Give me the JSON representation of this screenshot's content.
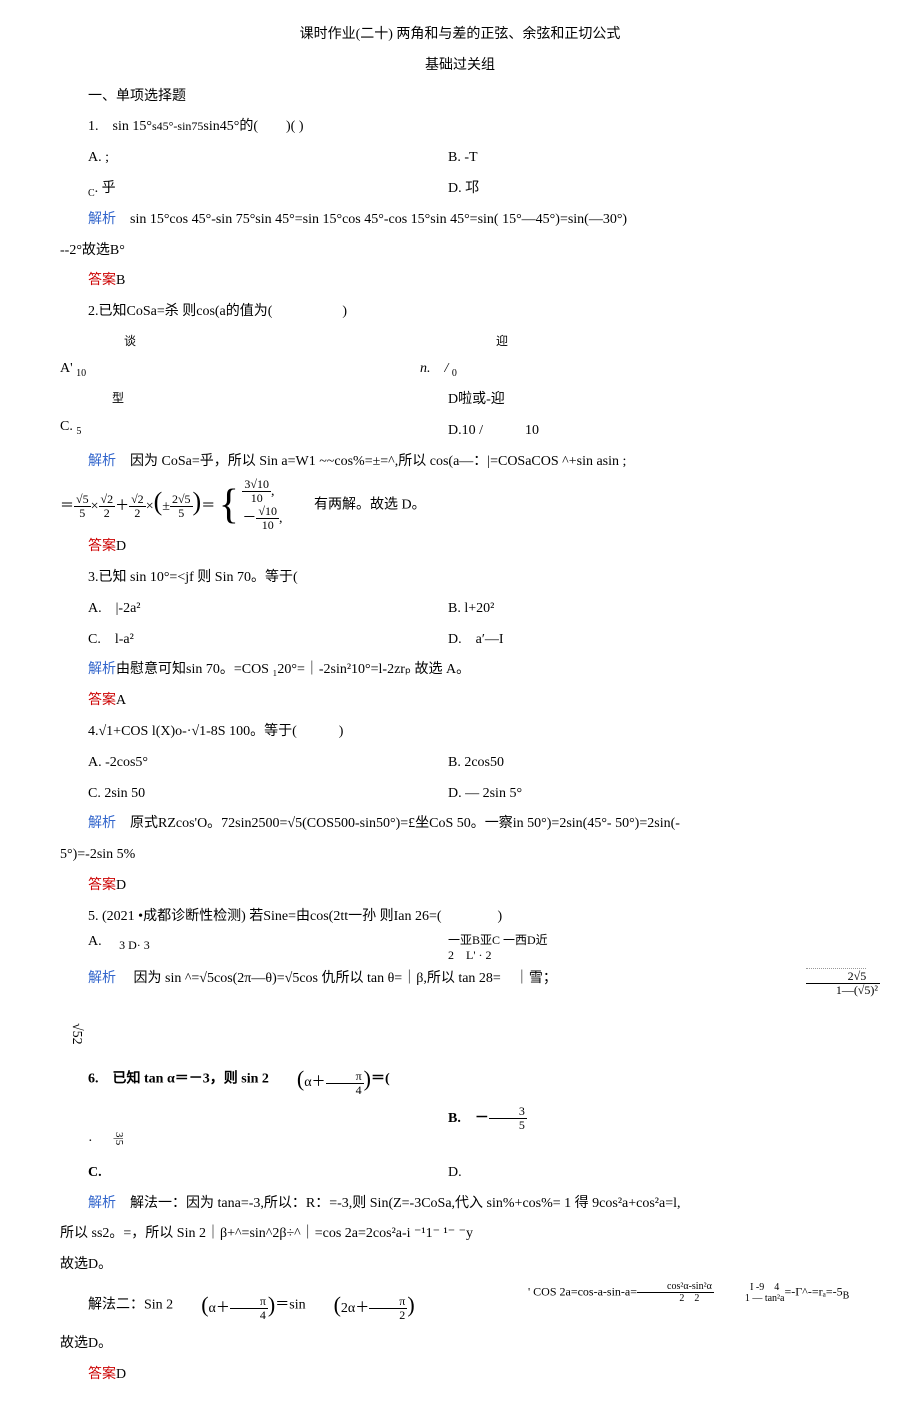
{
  "header": {
    "title": "课时作业(二十) 两角和与差的正弦、余弦和正切公式",
    "subtitle": "基础过关组"
  },
  "s1_title": "一、单项选择题",
  "q1": {
    "stem_pre": "1.　sin 15°",
    "stem_mid": "s45°-sin75",
    "stem_post": "sin45°的(　　)(  )",
    "A": "A. ;",
    "B": "B. -T",
    "C_pre": "C",
    "C_post": ". 乎",
    "D": "D. 邛",
    "analysis_label": "解析",
    "analysis": "　sin 15°cos 45°-sin 75°sin 45°=sin 15°cos 45°-cos 15°sin 45°=sin( 15°—45°)=sin(—30°)",
    "analysis_tail": "--2°故选B°",
    "answer_label": "答案",
    "answer": "B"
  },
  "q2": {
    "stem": "2.已知CoSa=杀 则cos(a的值为(　　　　　)",
    "A_pre": "A",
    "A_post": "' ",
    "A_sub": "10",
    "A_top": "谈",
    "B_pre": "n.　/ ",
    "B_sub": "0",
    "B_top": "迎",
    "C_pre": "C. ",
    "C_sub": "5",
    "C_top": "型",
    "D": "D啦或-迎",
    "D2": "D.10 /　　　10",
    "analysis_label": "解析",
    "analysis": "　因为 CoSa=乎，所以 Sin a=W1 ~~cos%=±=^,所以 cos(a—：|=COSaCOS ^+sin asin ;",
    "tail": "　　有两解。故选 D。",
    "answer_label": "答案",
    "answer": "D"
  },
  "q3": {
    "stem": "3.已知 sin 10°=<jf 则 Sin 70。等于(",
    "A": "A.　|-2a²",
    "B": "B. l+20²",
    "C": "C.　l-a²",
    "D": "D.　a′—I",
    "analysis_label": "解析",
    "analysis": "由慰意可知sin 70。=COS ₁20°=｜-2sin²10°=l-2zrₚ 故选 A。",
    "answer_label": "答案",
    "answer": "A"
  },
  "q4": {
    "stem": "4.√1+COS l(X)o-·√1-8S 100。等于(　　　)",
    "A": "A. -2cos5°",
    "B": "B. 2cos50",
    "C": "C. 2sin 50",
    "D": "D. — 2sin 5°",
    "analysis_label": "解析",
    "analysis": "　原式RZcos'O。72sin2500=√5(COS500-sin50°)=£坐CoS 50。一察in 50°)=2sin(45°- 50°)=2sin(-",
    "analysis_tail": "5°)=-2sin 5%",
    "answer_label": "答案",
    "answer": "D"
  },
  "q5": {
    "stem": "5. (2021 •成都诊断性检测) 若Sine=由cos(2tt一孙 则Ian 26=(　　　　)",
    "opts_a": "A.　",
    "opts_mid": "3 D· 3",
    "opts_b": "一亚B亚C 一西D近",
    "opts_c": "2　L' · 2",
    "analysis_label": "解析",
    "analysis": "　 因为 sin ^=√5cos(2π—θ)=√5cos 仇所以 tan θ=｜β,所以 tan 28=　｜雪；",
    "tail_sym": "√52",
    "frac_num": "2√5",
    "frac_den": "1—(√5)²"
  },
  "q6": {
    "stem_pre": "6.　已知 tan α＝－3，则 sin 2",
    "stem_post": "＝(",
    "paren_inner_a": "α＋",
    "paren_inner_frac_n": "π",
    "paren_inner_frac_d": "4",
    "A_pre": "·　",
    "A_sym": "3|5",
    "B_pre": "B.　－",
    "B_n": "3",
    "B_d": "5",
    "C": "C.",
    "D": "D.",
    "analysis_label": "解析",
    "analysis1": "　解法一：因为 tana=-3,所以：R：=-3,则 Sin(Z=-3CoSa,代入 sin%+cos%= 1 得 9cos²a+cos²a=l,",
    "analysis2": "所以 ss2。=，所以 Sin 2｜β+^=sin^2β÷^｜=cos 2a=2cos²a-i ⁻¹1⁻ ¹⁻ ⁻y",
    "analysis3": "故选D。",
    "analysis4_pre": "解法二：Sin 2",
    "analysis4_mid": "＝sin",
    "analysis4_r1": "' COS 2a=cos-a-sin-a=",
    "analysis4_r2_n": "cos²α-sin²α",
    "analysis4_r2_d": "2　2",
    "analysis4_r3_n": "1 — tan²a",
    "analysis4_r3_post": "=-Γ^-=rₐ=-5",
    "analysis4_r4": "I -9　4",
    "analysis4_r_sub": "B",
    "analysis5": "故选D。",
    "answer_label": "答案",
    "answer": "D"
  }
}
